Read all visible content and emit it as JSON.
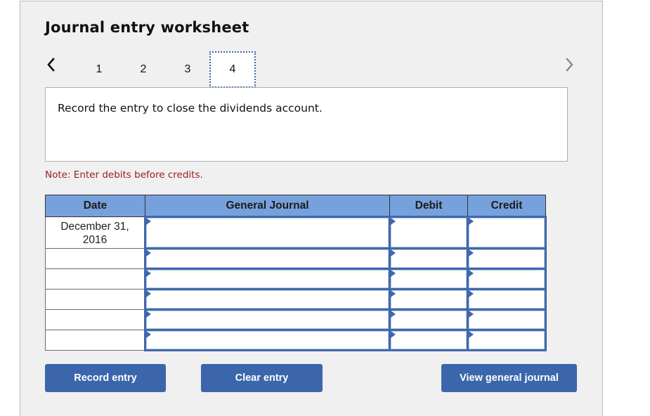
{
  "worksheet": {
    "title": "Journal entry worksheet",
    "nav": {
      "prev_icon": "chevron-left-icon",
      "next_icon": "chevron-right-icon",
      "tabs": [
        {
          "label": "1",
          "active": false
        },
        {
          "label": "2",
          "active": false
        },
        {
          "label": "3",
          "active": false
        },
        {
          "label": "4",
          "active": true
        }
      ]
    },
    "prompt": "Record the entry to close the dividends account.",
    "note": "Note: Enter debits before credits."
  },
  "journal": {
    "headers": {
      "date": "Date",
      "general_journal": "General Journal",
      "debit": "Debit",
      "credit": "Credit"
    },
    "rows": [
      {
        "date": "December 31, 2016",
        "account": "",
        "debit": "",
        "credit": ""
      },
      {
        "date": "",
        "account": "",
        "debit": "",
        "credit": ""
      },
      {
        "date": "",
        "account": "",
        "debit": "",
        "credit": ""
      },
      {
        "date": "",
        "account": "",
        "debit": "",
        "credit": ""
      },
      {
        "date": "",
        "account": "",
        "debit": "",
        "credit": ""
      },
      {
        "date": "",
        "account": "",
        "debit": "",
        "credit": ""
      }
    ]
  },
  "buttons": {
    "record": "Record entry",
    "clear": "Clear entry",
    "view_journal": "View general journal"
  },
  "colors": {
    "accent": "#3c66ab",
    "header_bg": "#76a1dc",
    "note": "#9b1c1c",
    "panel_bg": "#f0f0f0"
  }
}
